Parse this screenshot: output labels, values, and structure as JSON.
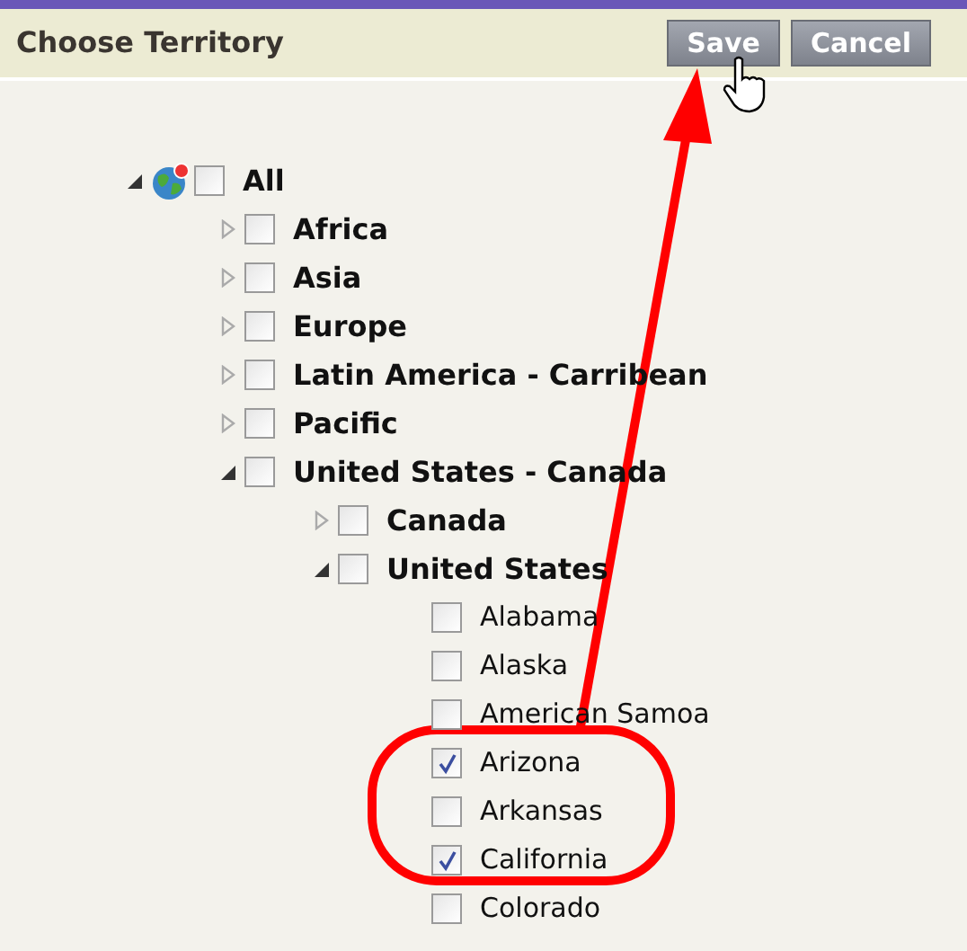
{
  "header": {
    "title": "Choose Territory",
    "buttons": [
      "Save",
      "Cancel"
    ]
  },
  "tree": [
    {
      "label": "All",
      "expanded": true,
      "checked": false,
      "children": [
        {
          "label": "Africa",
          "expanded": false,
          "checked": false
        },
        {
          "label": "Asia",
          "expanded": false,
          "checked": false
        },
        {
          "label": "Europe",
          "expanded": false,
          "checked": false
        },
        {
          "label": "Latin America - Carribean",
          "expanded": false,
          "checked": false
        },
        {
          "label": "Pacific",
          "expanded": false,
          "checked": false
        },
        {
          "label": "United States - Canada",
          "expanded": true,
          "checked": false,
          "children": [
            {
              "label": "Canada",
              "expanded": false,
              "checked": false
            },
            {
              "label": "United States",
              "expanded": true,
              "checked": false,
              "children": [
                {
                  "label": "Alabama",
                  "checked": false
                },
                {
                  "label": "Alaska",
                  "checked": false
                },
                {
                  "label": "American Samoa",
                  "checked": false
                },
                {
                  "label": "Arizona",
                  "checked": true
                },
                {
                  "label": "Arkansas",
                  "checked": false
                },
                {
                  "label": "California",
                  "checked": true
                },
                {
                  "label": "Colorado",
                  "checked": false
                }
              ]
            }
          ]
        }
      ]
    }
  ]
}
